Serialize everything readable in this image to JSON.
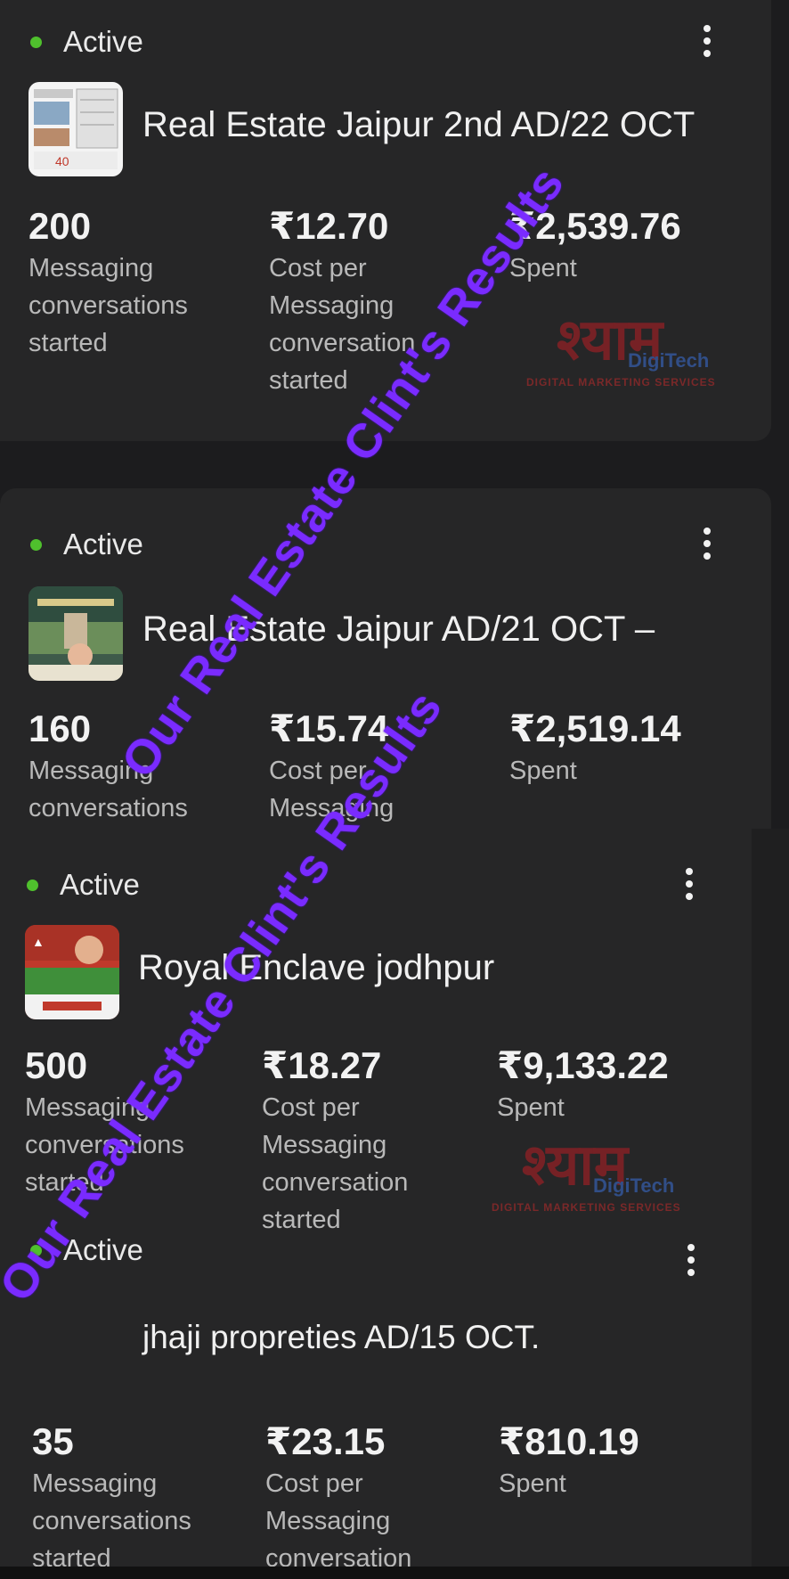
{
  "status_label": "Active",
  "cards": [
    {
      "title": "Real Estate Jaipur 2nd AD/22 OCT",
      "metrics": [
        {
          "value": "200",
          "label": "Messaging conversations started"
        },
        {
          "value": "₹12.70",
          "label": "Cost per Messaging conversation started"
        },
        {
          "value": "₹2,539.76",
          "label": "Spent"
        }
      ]
    },
    {
      "title": "Real Estate Jaipur AD/21 OCT –",
      "metrics": [
        {
          "value": "160",
          "label": "Messaging conversations"
        },
        {
          "value": "₹15.74",
          "label": "Cost per Messaging"
        },
        {
          "value": "₹2,519.14",
          "label": "Spent"
        }
      ]
    },
    {
      "title": "Royal Enclave jodhpur",
      "metrics": [
        {
          "value": "500",
          "label": "Messaging conversations started"
        },
        {
          "value": "₹18.27",
          "label": "Cost per Messaging conversation started"
        },
        {
          "value": "₹9,133.22",
          "label": "Spent"
        }
      ]
    },
    {
      "title": "jhaji propreties AD/15 OCT.",
      "metrics": [
        {
          "value": "35",
          "label": "Messaging conversations started"
        },
        {
          "value": "₹23.15",
          "label": "Cost per Messaging conversation"
        },
        {
          "value": "₹810.19",
          "label": "Spent"
        }
      ]
    }
  ],
  "watermark": {
    "text": "Our Real Estate Clint's Results",
    "color": "#7a2bff"
  },
  "logo": {
    "script_text": "श्याम",
    "brand": "DigiTech",
    "tagline": "DIGITAL MARKETING SERVICES"
  },
  "colors": {
    "active_dot": "#4fc02d",
    "card_bg": "#262627",
    "page_bg": "#1c1c1e"
  }
}
